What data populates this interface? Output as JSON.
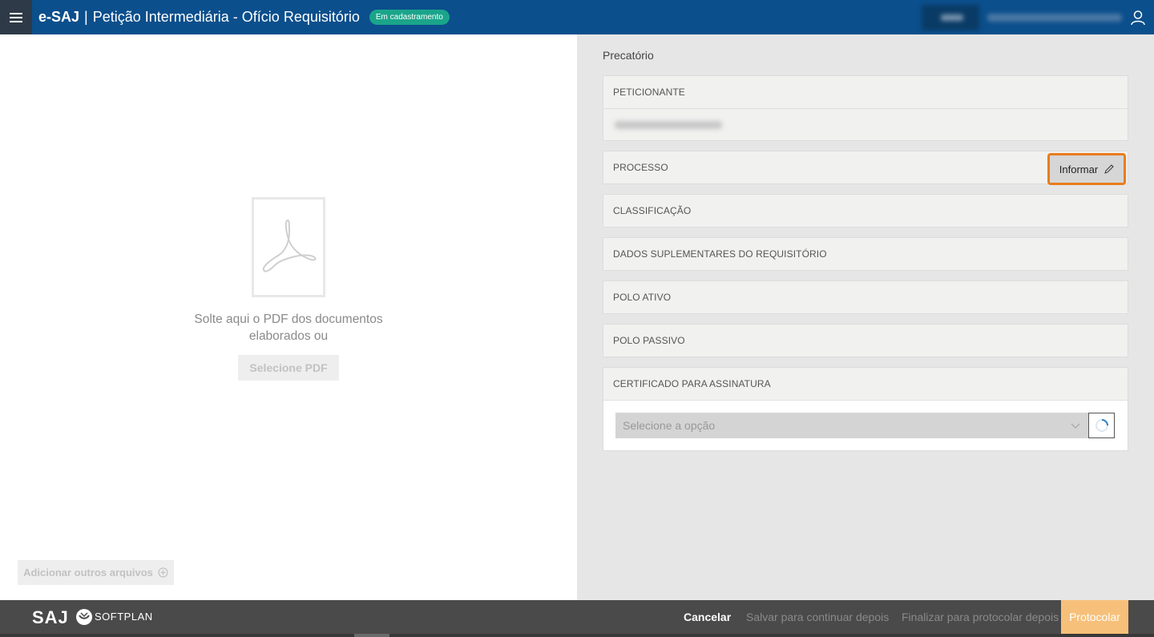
{
  "header": {
    "brand": "e-SAJ",
    "separator": "|",
    "title": "Petição Intermediária - Ofício Requisitório",
    "status_badge": "Em cadastramento",
    "icons": {
      "menu": "hamburger-menu-icon",
      "user": "user-icon"
    }
  },
  "left": {
    "drop_text_line1": "Solte aqui o PDF dos documentos",
    "drop_text_line2": "elaborados ou",
    "select_pdf_label": "Selecione PDF",
    "add_files_label": "Adicionar outros arquivos",
    "icons": {
      "pdf": "pdf-document-icon",
      "add": "plus-circle-icon"
    }
  },
  "right": {
    "section_title": "Precatório",
    "cards": {
      "peticionante": "PETICIONANTE",
      "processo": "PROCESSO",
      "informar_label": "Informar",
      "classificacao": "CLASSIFICAÇÃO",
      "dados_suplementares": "DADOS SUPLEMENTARES DO REQUISITÓRIO",
      "polo_ativo": "POLO ATIVO",
      "polo_passivo": "POLO PASSIVO",
      "certificado": "CERTIFICADO PARA ASSINATURA"
    },
    "cert_select_placeholder": "Selecione a opção",
    "icons": {
      "edit": "pencil-icon",
      "chevron": "chevron-down-icon",
      "loading": "loading-spinner-icon"
    }
  },
  "footer": {
    "logo_text": "SAJ",
    "softplan_text": "SOFTPLAN",
    "cancel_label": "Cancelar",
    "save_label": "Salvar para continuar depois",
    "finalize_label": "Finalizar para protocolar depois",
    "protocol_label": "Protocolar"
  },
  "colors": {
    "header_bg": "#0b4f8c",
    "badge": "#1aa58a",
    "highlight": "#e87d1e",
    "protocol_btn": "#f7c07a",
    "footer_bg": "#4a4a4a"
  }
}
